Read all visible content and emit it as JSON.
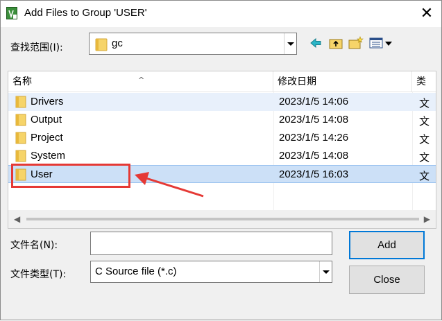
{
  "window": {
    "title": "Add Files to Group 'USER'",
    "close_glyph": "✕"
  },
  "lookin": {
    "label": "查找范围(I):",
    "value": "gc"
  },
  "toolbar": {
    "icons": [
      "back-arrow-icon",
      "up-folder-icon",
      "new-folder-icon",
      "view-menu-icon"
    ]
  },
  "list": {
    "columns": [
      "名称",
      "修改日期",
      "类"
    ],
    "rows": [
      {
        "name": "Drivers",
        "date": "2023/1/5 14:06",
        "type": "文"
      },
      {
        "name": "Output",
        "date": "2023/1/5 14:08",
        "type": "文"
      },
      {
        "name": "Project",
        "date": "2023/1/5 14:26",
        "type": "文"
      },
      {
        "name": "System",
        "date": "2023/1/5 14:08",
        "type": "文"
      },
      {
        "name": "User",
        "date": "2023/1/5 16:03",
        "type": "文"
      }
    ],
    "selected_index": 4
  },
  "filename": {
    "label": "文件名(N):",
    "value": ""
  },
  "filetype": {
    "label": "文件类型(T):",
    "value": "C Source file (*.c)"
  },
  "buttons": {
    "add": "Add",
    "close": "Close"
  },
  "colors": {
    "selection": "#cce0f7",
    "annotation": "#e53935",
    "accent": "#0078d7"
  }
}
